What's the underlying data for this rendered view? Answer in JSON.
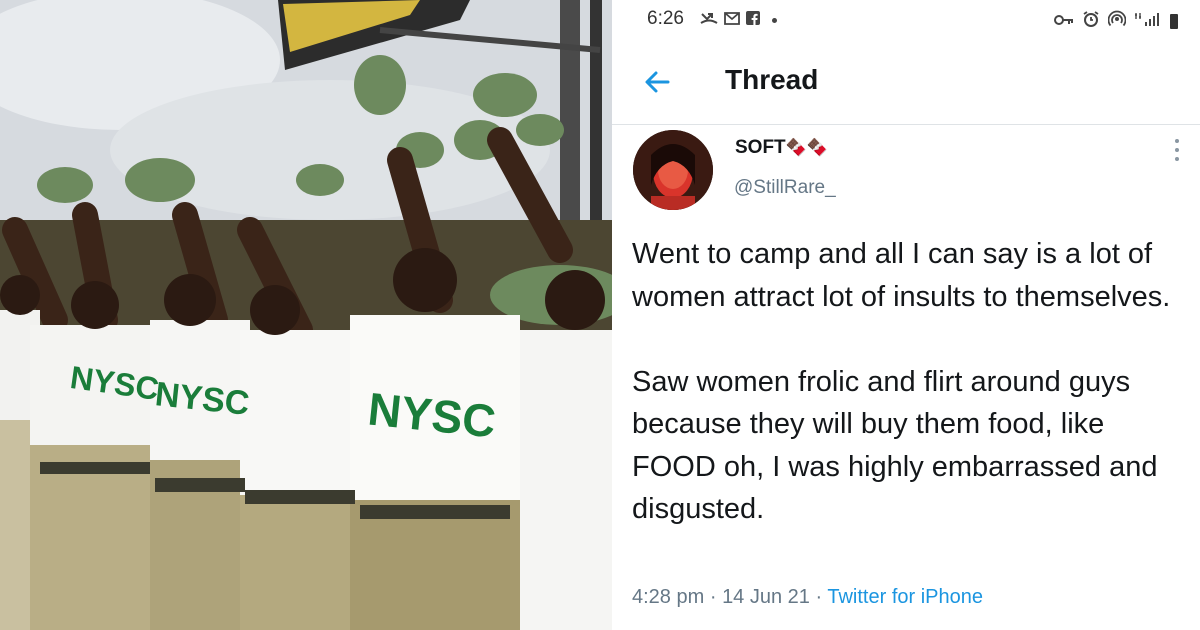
{
  "photo": {
    "description_icon": "photo-icon",
    "shirt_text": "NYSC"
  },
  "status_bar": {
    "time": "6:26",
    "left_icons": [
      "missed-call-icon",
      "gmail-icon",
      "facebook-icon"
    ],
    "right_icons": [
      "key-icon",
      "alarm-icon",
      "hotspot-icon",
      "signal-icon",
      "battery-icon"
    ]
  },
  "header": {
    "title": "Thread",
    "back_icon": "back-arrow-icon"
  },
  "tweet": {
    "display_name": "SOFT",
    "name_emoji": "🍫🍫",
    "handle": "@StillRare_",
    "text": "Went to camp and all I can say is a lot of women attract lot of insults to themselves.\n\nSaw women frolic and flirt around guys because they will buy them food, like FOOD oh, I was highly embarrassed and disgusted.",
    "time": "4:28 pm",
    "date": "14 Jun 21",
    "source": "Twitter for iPhone",
    "separator": "·"
  },
  "colors": {
    "accent": "#1b95e0",
    "text": "#14171a",
    "muted": "#657786"
  }
}
